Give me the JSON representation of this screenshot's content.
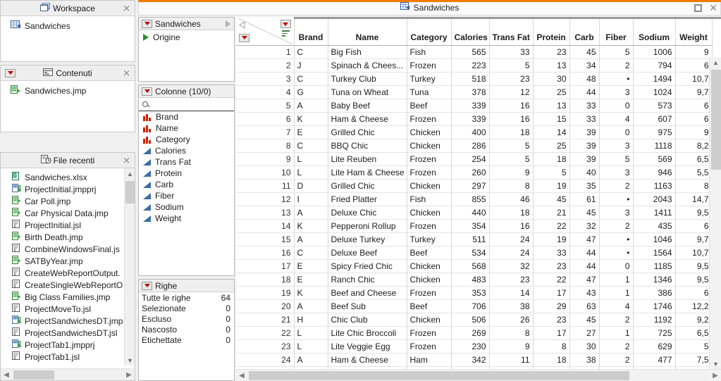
{
  "window": {
    "title": "Sandwiches",
    "title_icon": "data-table-icon",
    "maximize_label": "",
    "close_label": "✕",
    "accent_color": "#f07D00"
  },
  "workspace_panel": {
    "title": "Workspace",
    "icon": "windows-stack-icon",
    "close_label": "✕",
    "items": [
      {
        "label": "Sandwiches",
        "icon": "data-table-icon"
      }
    ]
  },
  "contenuti_panel": {
    "title": "Contenuti",
    "icon": "contents-icon",
    "close_label": "✕",
    "items": [
      {
        "label": "Sandwiches.jmp",
        "icon": "jmp-file-icon"
      }
    ]
  },
  "recenti_panel": {
    "title": "File recenti",
    "icon": "recent-files-icon",
    "close_label": "✕",
    "files": [
      {
        "label": "Sandwiches.xlsx",
        "icon": "xlsx-file-icon"
      },
      {
        "label": "ProjectInitial.jmpprj",
        "icon": "jmpprj-file-icon"
      },
      {
        "label": "Car Poll.jmp",
        "icon": "jmp-file-icon"
      },
      {
        "label": "Car Physical Data.jmp",
        "icon": "jmp-file-icon"
      },
      {
        "label": "ProjectInitial.jsl",
        "icon": "jsl-file-icon"
      },
      {
        "label": "Birth Death.jmp",
        "icon": "jmp-file-icon"
      },
      {
        "label": "CombineWindowsFinal.js",
        "icon": "jsl-file-icon"
      },
      {
        "label": "SATByYear.jmp",
        "icon": "jmp-file-icon"
      },
      {
        "label": "CreateWebReportOutput.",
        "icon": "jsl-file-icon"
      },
      {
        "label": "CreateSingleWebReportO",
        "icon": "jsl-file-icon"
      },
      {
        "label": "Big Class Families.jmp",
        "icon": "jmp-file-icon"
      },
      {
        "label": "ProjectMoveTo.jsl",
        "icon": "jsl-file-icon"
      },
      {
        "label": "ProjectSandwichesDT.jmp",
        "icon": "jmpprj-file-icon"
      },
      {
        "label": "ProjectSandwichesDT.jsl",
        "icon": "jsl-file-icon"
      },
      {
        "label": "ProjectTab1.jmpprj",
        "icon": "jmpprj-file-icon"
      },
      {
        "label": "ProjectTab1.jsl",
        "icon": "jsl-file-icon"
      }
    ]
  },
  "table_panel": {
    "title": "Sandwiches",
    "expand_icon": "triangle-right-icon",
    "items": [
      {
        "label": "Origine",
        "icon": "green-triangle-icon"
      }
    ]
  },
  "columns_panel": {
    "title": "Colonne (10/0)",
    "search_placeholder": "",
    "search_icon": "search-icon",
    "columns": [
      {
        "label": "Brand",
        "type": "nominal"
      },
      {
        "label": "Name",
        "type": "nominal"
      },
      {
        "label": "Category",
        "type": "nominal"
      },
      {
        "label": "Calories",
        "type": "continuous"
      },
      {
        "label": "Trans Fat",
        "type": "continuous"
      },
      {
        "label": "Protein",
        "type": "continuous"
      },
      {
        "label": "Carb",
        "type": "continuous"
      },
      {
        "label": "Fiber",
        "type": "continuous"
      },
      {
        "label": "Sodium",
        "type": "continuous"
      },
      {
        "label": "Weight",
        "type": "continuous"
      }
    ]
  },
  "rows_panel": {
    "title": "Righe",
    "stats": [
      {
        "label": "Tutte le righe",
        "value": "64"
      },
      {
        "label": "Selezionate",
        "value": "0"
      },
      {
        "label": "Escluso",
        "value": "0"
      },
      {
        "label": "Nascosto",
        "value": "0"
      },
      {
        "label": "Etichettate",
        "value": "0"
      }
    ]
  },
  "grid": {
    "columns": [
      "Brand",
      "Name",
      "Category",
      "Calories",
      "Trans Fat",
      "Protein",
      "Carb",
      "Fiber",
      "Sodium",
      "Weight"
    ],
    "rows": [
      {
        "n": "1",
        "cells": [
          "C",
          "Big Fish",
          "Fish",
          "565",
          "33",
          "23",
          "45",
          "5",
          "1006",
          "9"
        ]
      },
      {
        "n": "2",
        "cells": [
          "J",
          "Spinach & Chees...",
          "Frozen",
          "223",
          "5",
          "13",
          "34",
          "2",
          "794",
          "6"
        ]
      },
      {
        "n": "3",
        "cells": [
          "C",
          "Turkey Club",
          "Turkey",
          "518",
          "23",
          "30",
          "48",
          "•",
          "1494",
          "10,7"
        ]
      },
      {
        "n": "4",
        "cells": [
          "G",
          "Tuna on Wheat",
          "Tuna",
          "378",
          "12",
          "25",
          "44",
          "3",
          "1024",
          "9,7"
        ]
      },
      {
        "n": "5",
        "cells": [
          "A",
          "Baby Beef",
          "Beef",
          "339",
          "16",
          "13",
          "33",
          "0",
          "573",
          "6"
        ]
      },
      {
        "n": "6",
        "cells": [
          "K",
          "Ham & Cheese",
          "Frozen",
          "339",
          "16",
          "15",
          "33",
          "4",
          "607",
          "6"
        ]
      },
      {
        "n": "7",
        "cells": [
          "E",
          "Grilled Chic",
          "Chicken",
          "400",
          "18",
          "14",
          "39",
          "0",
          "975",
          "9"
        ]
      },
      {
        "n": "8",
        "cells": [
          "C",
          "BBQ Chic",
          "Chicken",
          "286",
          "5",
          "25",
          "39",
          "3",
          "1118",
          "8,2"
        ]
      },
      {
        "n": "9",
        "cells": [
          "L",
          "Lite Reuben",
          "Frozen",
          "254",
          "5",
          "18",
          "39",
          "5",
          "569",
          "6,5"
        ]
      },
      {
        "n": "10",
        "cells": [
          "L",
          "Lite Ham & Cheese",
          "Frozen",
          "260",
          "9",
          "5",
          "40",
          "3",
          "946",
          "5,5"
        ]
      },
      {
        "n": "11",
        "cells": [
          "D",
          "Grilled Chic",
          "Chicken",
          "297",
          "8",
          "19",
          "35",
          "2",
          "1163",
          "8"
        ]
      },
      {
        "n": "12",
        "cells": [
          "I",
          "Fried Platter",
          "Fish",
          "855",
          "46",
          "45",
          "61",
          "•",
          "2043",
          "14,7"
        ]
      },
      {
        "n": "13",
        "cells": [
          "A",
          "Deluxe Chic",
          "Chicken",
          "440",
          "18",
          "21",
          "45",
          "3",
          "1411",
          "9,5"
        ]
      },
      {
        "n": "14",
        "cells": [
          "K",
          "Pepperoni Rollup",
          "Frozen",
          "354",
          "16",
          "22",
          "32",
          "2",
          "435",
          "6"
        ]
      },
      {
        "n": "15",
        "cells": [
          "A",
          "Deluxe Turkey",
          "Turkey",
          "511",
          "24",
          "19",
          "47",
          "•",
          "1046",
          "9,7"
        ]
      },
      {
        "n": "16",
        "cells": [
          "C",
          "Deluxe Beef",
          "Beef",
          "534",
          "24",
          "33",
          "44",
          "•",
          "1564",
          "10,7"
        ]
      },
      {
        "n": "17",
        "cells": [
          "E",
          "Spicy Fried Chic",
          "Chicken",
          "568",
          "32",
          "23",
          "44",
          "0",
          "1185",
          "9,5"
        ]
      },
      {
        "n": "18",
        "cells": [
          "E",
          "Ranch Chic",
          "Chicken",
          "483",
          "23",
          "22",
          "47",
          "1",
          "1346",
          "9,5"
        ]
      },
      {
        "n": "19",
        "cells": [
          "K",
          "Beef and Cheese",
          "Frozen",
          "353",
          "14",
          "17",
          "43",
          "1",
          "386",
          "6"
        ]
      },
      {
        "n": "20",
        "cells": [
          "A",
          "Beef Sub",
          "Beef",
          "706",
          "38",
          "29",
          "63",
          "4",
          "1746",
          "12,2"
        ]
      },
      {
        "n": "21",
        "cells": [
          "H",
          "Chic Club",
          "Chicken",
          "506",
          "26",
          "23",
          "45",
          "2",
          "1192",
          "9,2"
        ]
      },
      {
        "n": "22",
        "cells": [
          "L",
          "Lite Chic Broccoli",
          "Frozen",
          "269",
          "8",
          "17",
          "27",
          "1",
          "725",
          "6,5"
        ]
      },
      {
        "n": "23",
        "cells": [
          "L",
          "Lite Veggie Egg",
          "Frozen",
          "230",
          "9",
          "8",
          "30",
          "2",
          "629",
          "5"
        ]
      },
      {
        "n": "24",
        "cells": [
          "A",
          "Ham & Cheese",
          "Ham",
          "342",
          "11",
          "18",
          "38",
          "2",
          "477",
          "7,5"
        ]
      },
      {
        "n": "25",
        "cells": [
          "",
          "",
          "",
          "",
          "",
          "",
          "",
          "",
          "",
          ""
        ]
      }
    ]
  }
}
